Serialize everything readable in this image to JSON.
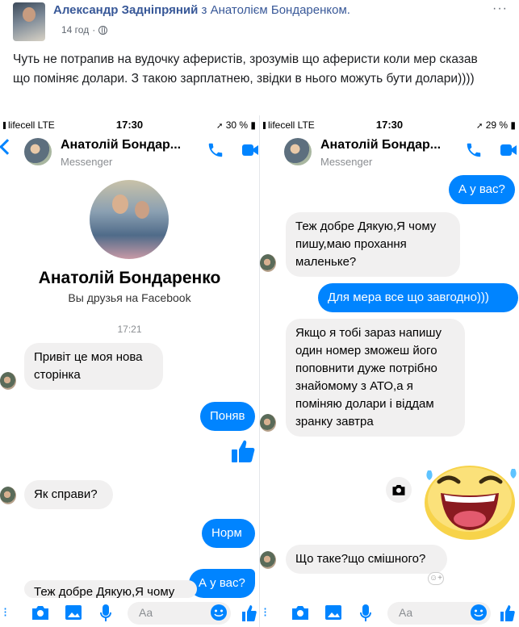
{
  "post": {
    "author": "Александр Задніпряний",
    "with": "з",
    "tagged": "Анатолієм Бондаренком.",
    "time": "14 год",
    "more": "···",
    "text": "Чуть не потрапив на вудочку аферистів, зрозумів що аферисти коли мер сказав що поміняє долари. З такою зарплатнею, звідки в нього можуть бути долари))))"
  },
  "left_phone": {
    "status": {
      "carrier": "lifecell  LTE",
      "time": "17:30",
      "battery": "30 %"
    },
    "header": {
      "name": "Анатолій Бондар...",
      "subtitle": "Messenger"
    },
    "profile": {
      "name": "Анатолій Бондаренко",
      "friends": "Вы друзья на Facebook"
    },
    "timestamp": "17:21",
    "messages": [
      {
        "dir": "in",
        "text": "Привіт це моя нова\nсторінка"
      },
      {
        "dir": "out",
        "text": "Поняв"
      },
      {
        "dir": "in",
        "text": "Як справи?"
      },
      {
        "dir": "out",
        "text": "Норм"
      },
      {
        "dir": "out",
        "text": "А у вас?"
      },
      {
        "dir": "in",
        "text": "Теж добре Дякую,Я чому"
      }
    ],
    "composer_placeholder": "Aa"
  },
  "right_phone": {
    "status": {
      "carrier": "lifecell  LTE",
      "time": "17:30",
      "battery": "29 %"
    },
    "header": {
      "name": "Анатолій Бондар...",
      "subtitle": "Messenger"
    },
    "messages": [
      {
        "dir": "out",
        "text": "А у вас?"
      },
      {
        "dir": "in",
        "text": "Теж добре Дякую,Я чому\nпишу,маю прохання\nмаленьке?"
      },
      {
        "dir": "out",
        "text": "Для мера все що завгодно)))"
      },
      {
        "dir": "in",
        "text": "Якщо я тобі зараз напишу\nодин номер зможеш його\nпоповнити дуже потрібно\nзнайомому з АТО,а я\nпоміняю долари і віддам\nзранку завтра"
      },
      {
        "dir": "in",
        "text": "Що таке?що смішного?"
      }
    ],
    "composer_placeholder": "Aa"
  },
  "colors": {
    "messenger_blue": "#0084ff",
    "fb_link": "#385898",
    "bubble_gray": "#f1f0f0"
  }
}
